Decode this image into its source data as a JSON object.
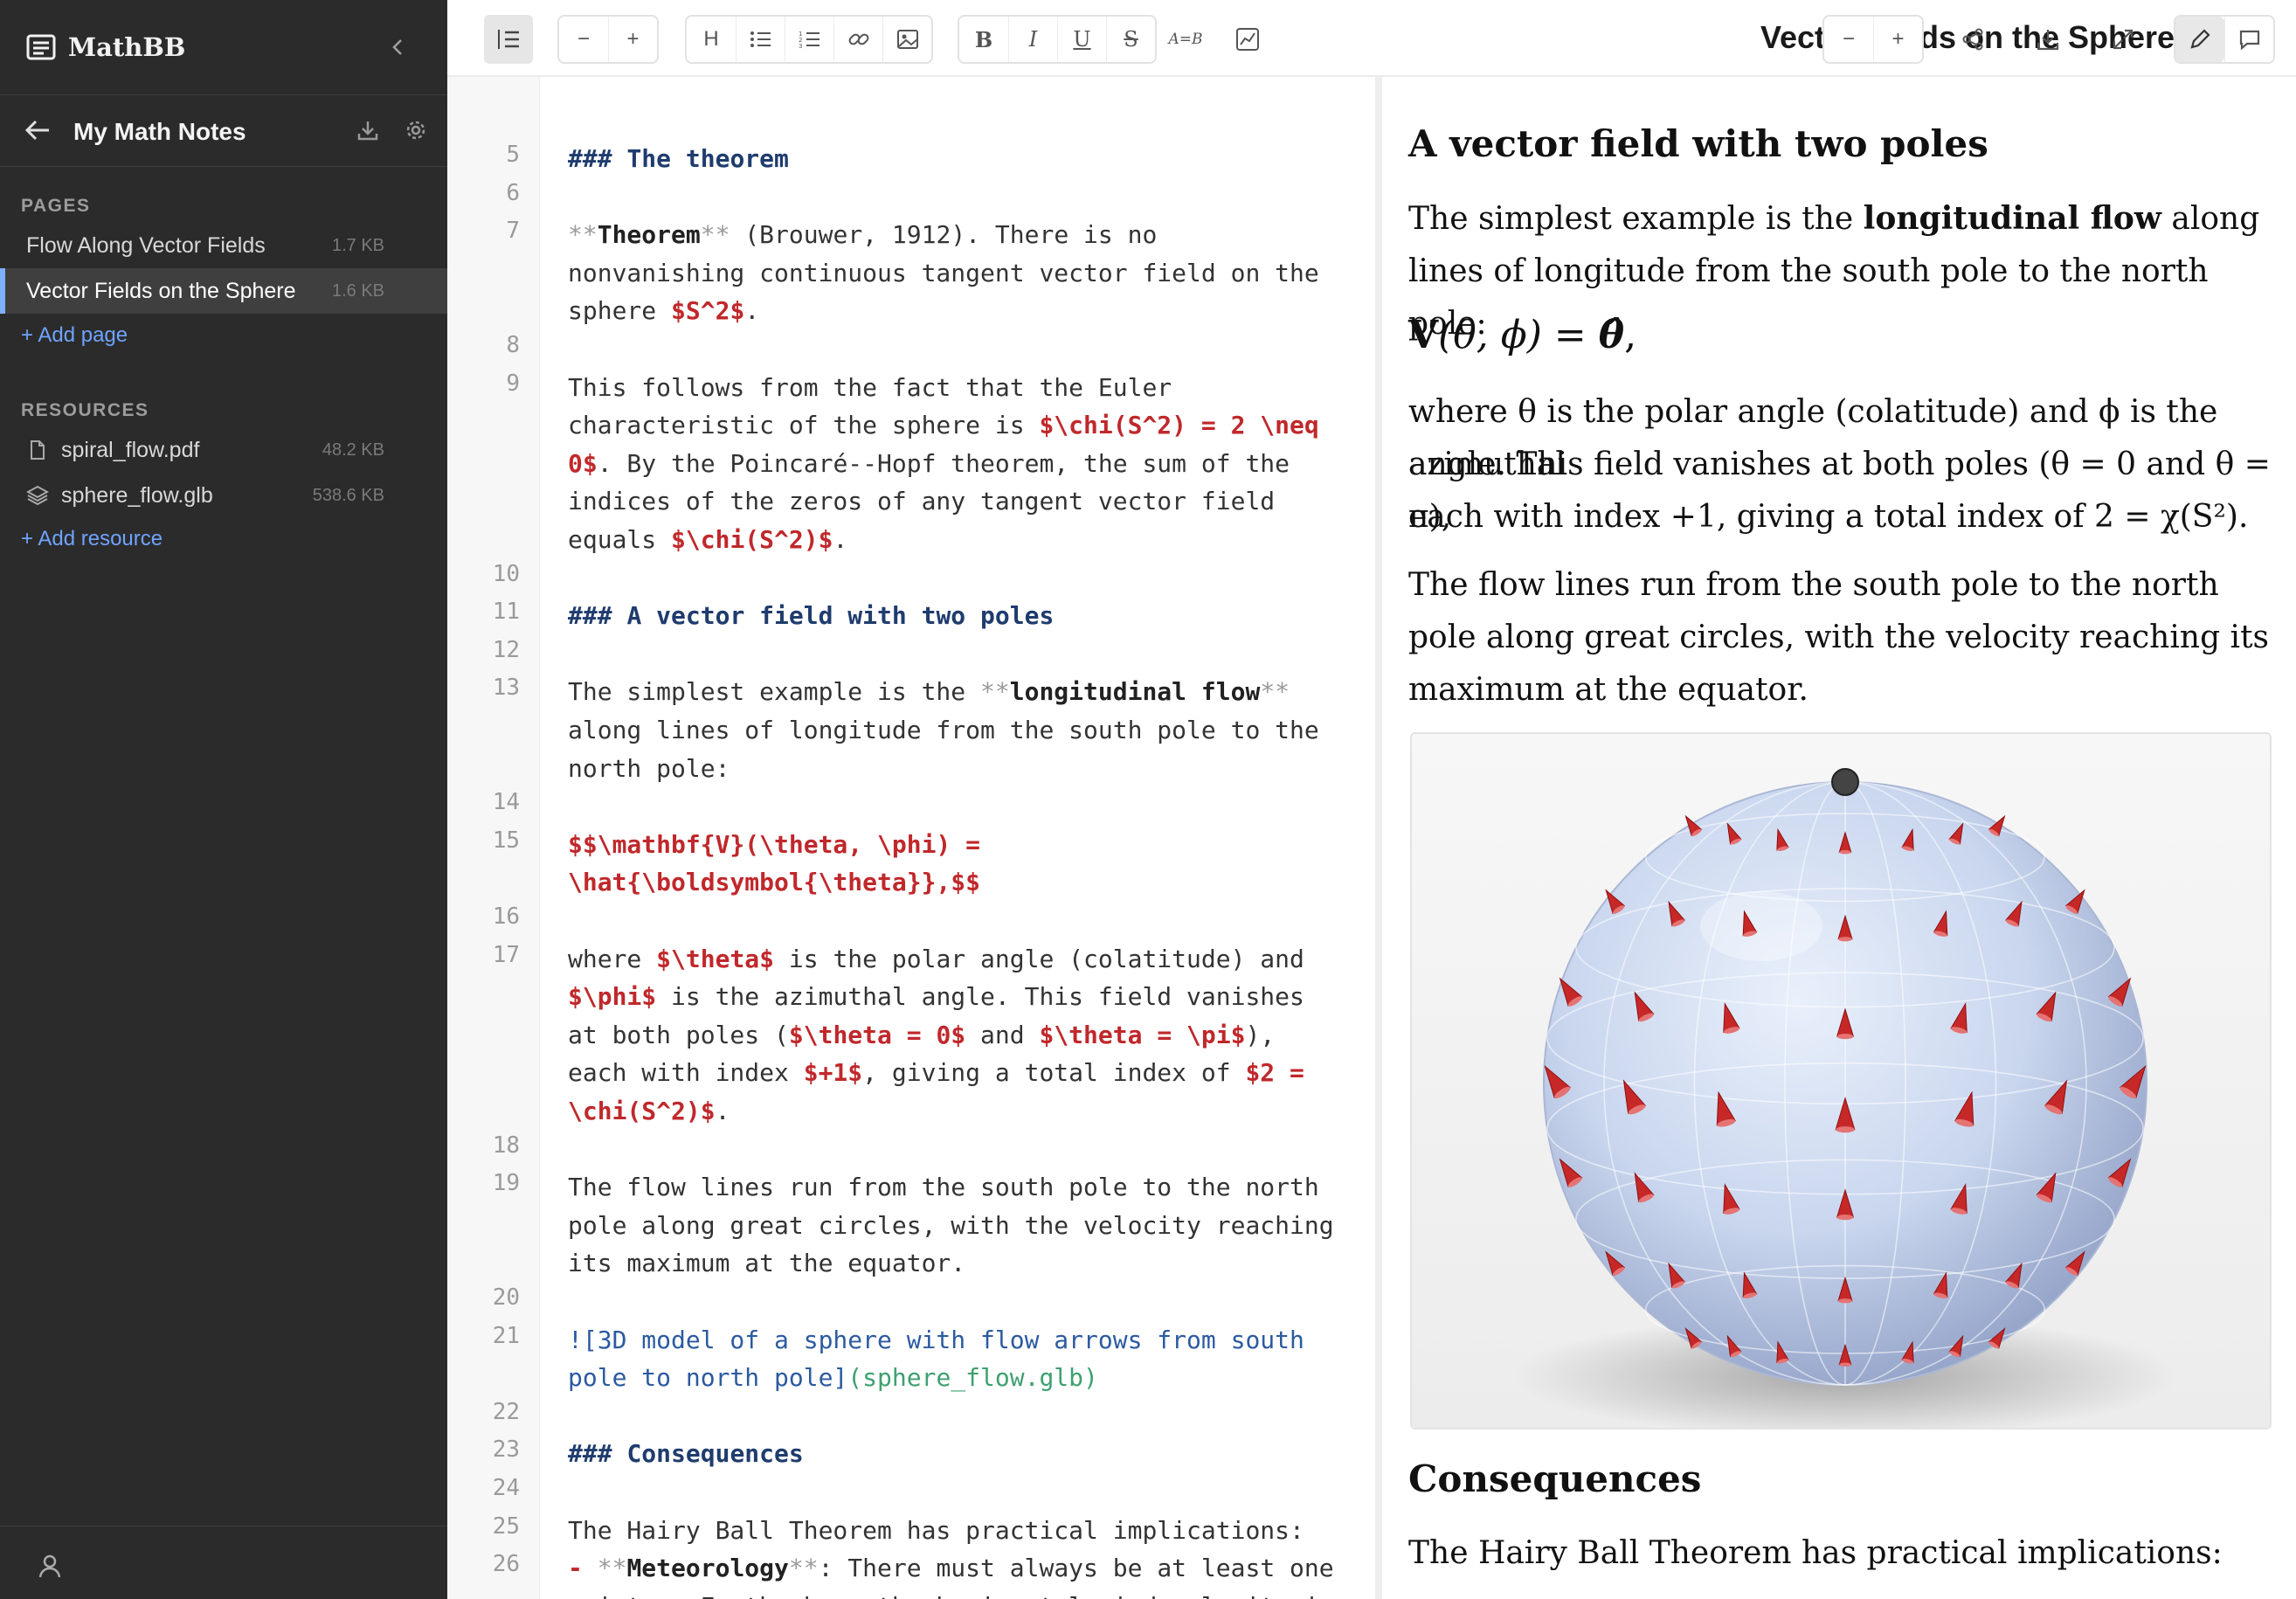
{
  "app": {
    "name": "MathBB"
  },
  "sidebar": {
    "notebook_title": "My Math Notes",
    "pages_heading": "PAGES",
    "pages": [
      {
        "label": "Flow Along Vector Fields",
        "size": "1.7 KB"
      },
      {
        "label": "Vector Fields on the Sphere",
        "size": "1.6 KB"
      }
    ],
    "add_page": "+ Add page",
    "resources_heading": "RESOURCES",
    "resources": [
      {
        "label": "spiral_flow.pdf",
        "size": "48.2 KB",
        "icon": "file-icon"
      },
      {
        "label": "sphere_flow.glb",
        "size": "538.6 KB",
        "icon": "3d-model-icon"
      }
    ],
    "add_resource": "+ Add resource"
  },
  "toolbar": {
    "doc_title": "Vector Fields on the Sphere",
    "zoom_out": "−",
    "zoom_in": "+",
    "heading": "H",
    "bold": "B",
    "italic": "I",
    "underline": "U",
    "strike": "S",
    "equation": "A=B"
  },
  "editor": {
    "lines": [
      {
        "n": "5",
        "parts": [
          {
            "t": "### ",
            "c": "h"
          },
          {
            "t": "The theorem",
            "c": "h"
          }
        ]
      },
      {
        "n": "6",
        "parts": []
      },
      {
        "n": "7",
        "parts": [
          {
            "t": "**",
            "c": "mk"
          },
          {
            "t": "Theorem",
            "c": "hb"
          },
          {
            "t": "**",
            "c": "mk"
          },
          {
            "t": " (Brouwer, 1912). There is no",
            "c": ""
          }
        ]
      },
      {
        "n": "",
        "parts": [
          {
            "t": "nonvanishing continuous tangent vector field on the",
            "c": ""
          }
        ]
      },
      {
        "n": "",
        "parts": [
          {
            "t": "sphere ",
            "c": ""
          },
          {
            "t": "$S^2$",
            "c": "m"
          },
          {
            "t": ".",
            "c": ""
          }
        ]
      },
      {
        "n": "8",
        "parts": []
      },
      {
        "n": "9",
        "parts": [
          {
            "t": "This follows from the fact that the Euler",
            "c": ""
          }
        ]
      },
      {
        "n": "",
        "parts": [
          {
            "t": "characteristic of the sphere is ",
            "c": ""
          },
          {
            "t": "$\\chi(S^2) = 2 \\neq",
            "c": "m"
          }
        ]
      },
      {
        "n": "",
        "parts": [
          {
            "t": "0$",
            "c": "m"
          },
          {
            "t": ". By the Poincaré--Hopf theorem, the sum of the",
            "c": ""
          }
        ]
      },
      {
        "n": "",
        "parts": [
          {
            "t": "indices of the zeros of any tangent vector field",
            "c": ""
          }
        ]
      },
      {
        "n": "",
        "parts": [
          {
            "t": "equals ",
            "c": ""
          },
          {
            "t": "$\\chi(S^2)$",
            "c": "m"
          },
          {
            "t": ".",
            "c": ""
          }
        ]
      },
      {
        "n": "10",
        "parts": []
      },
      {
        "n": "11",
        "parts": [
          {
            "t": "### ",
            "c": "h"
          },
          {
            "t": "A vector field with two poles",
            "c": "h"
          }
        ]
      },
      {
        "n": "12",
        "parts": []
      },
      {
        "n": "13",
        "parts": [
          {
            "t": "The simplest example is the ",
            "c": ""
          },
          {
            "t": "**",
            "c": "mk"
          },
          {
            "t": "longitudinal flow",
            "c": "hb"
          },
          {
            "t": "**",
            "c": "mk"
          }
        ]
      },
      {
        "n": "",
        "parts": [
          {
            "t": "along lines of longitude from the south pole to the",
            "c": ""
          }
        ]
      },
      {
        "n": "",
        "parts": [
          {
            "t": "north pole:",
            "c": ""
          }
        ]
      },
      {
        "n": "14",
        "parts": []
      },
      {
        "n": "15",
        "parts": [
          {
            "t": "$$\\mathbf{V}(\\theta, \\phi) =",
            "c": "m"
          }
        ]
      },
      {
        "n": "",
        "parts": [
          {
            "t": "\\hat{\\boldsymbol{\\theta}},$$",
            "c": "m"
          }
        ]
      },
      {
        "n": "16",
        "parts": []
      },
      {
        "n": "17",
        "parts": [
          {
            "t": "where ",
            "c": ""
          },
          {
            "t": "$\\theta$",
            "c": "m"
          },
          {
            "t": " is the polar angle (colatitude) and",
            "c": ""
          }
        ]
      },
      {
        "n": "",
        "parts": [
          {
            "t": "$\\phi$",
            "c": "m"
          },
          {
            "t": " is the azimuthal angle. This field vanishes",
            "c": ""
          }
        ]
      },
      {
        "n": "",
        "parts": [
          {
            "t": "at both poles (",
            "c": ""
          },
          {
            "t": "$\\theta = 0$",
            "c": "m"
          },
          {
            "t": " and ",
            "c": ""
          },
          {
            "t": "$\\theta = \\pi$",
            "c": "m"
          },
          {
            "t": "),",
            "c": ""
          }
        ]
      },
      {
        "n": "",
        "parts": [
          {
            "t": "each with index ",
            "c": ""
          },
          {
            "t": "$+1$",
            "c": "m"
          },
          {
            "t": ", giving a total index of ",
            "c": ""
          },
          {
            "t": "$2 =",
            "c": "m"
          }
        ]
      },
      {
        "n": "",
        "parts": [
          {
            "t": "\\chi(S^2)$",
            "c": "m"
          },
          {
            "t": ".",
            "c": ""
          }
        ]
      },
      {
        "n": "18",
        "parts": []
      },
      {
        "n": "19",
        "parts": [
          {
            "t": "The flow lines run from the south pole to the north",
            "c": ""
          }
        ]
      },
      {
        "n": "",
        "parts": [
          {
            "t": "pole along great circles, with the velocity reaching",
            "c": ""
          }
        ]
      },
      {
        "n": "",
        "parts": [
          {
            "t": "its maximum at the equator.",
            "c": ""
          }
        ]
      },
      {
        "n": "20",
        "parts": []
      },
      {
        "n": "21",
        "parts": [
          {
            "t": "![3D model of a sphere with flow arrows from south",
            "c": "lk"
          }
        ]
      },
      {
        "n": "",
        "parts": [
          {
            "t": "pole to north pole]",
            "c": "lk"
          },
          {
            "t": "(sphere_flow.glb)",
            "c": "url"
          }
        ]
      },
      {
        "n": "22",
        "parts": []
      },
      {
        "n": "23",
        "parts": [
          {
            "t": "### ",
            "c": "h"
          },
          {
            "t": "Consequences",
            "c": "h"
          }
        ]
      },
      {
        "n": "24",
        "parts": []
      },
      {
        "n": "25",
        "parts": [
          {
            "t": "The Hairy Ball Theorem has practical implications:",
            "c": ""
          }
        ]
      },
      {
        "n": "26",
        "parts": [
          {
            "t": "- ",
            "c": "m"
          },
          {
            "t": "**",
            "c": "mk"
          },
          {
            "t": "Meteorology",
            "c": "hb"
          },
          {
            "t": "**",
            "c": "mk"
          },
          {
            "t": ": There must always be at least one",
            "c": ""
          }
        ]
      },
      {
        "n": "",
        "parts": [
          {
            "t": "point on Earth where the horizontal wind velocity is",
            "c": ""
          }
        ]
      }
    ]
  },
  "preview": {
    "h_two_poles": "A vector field with two poles",
    "p1_a": "The simplest example is the ",
    "p1_b": "longitudinal flow",
    "p1_c": " along lines of longitude from the south pole to the north pole:",
    "eq_lhs": "V",
    "eq_args": "(θ, ϕ) = ",
    "eq_rhs": "θ̂",
    "eq_tail": ",",
    "p2_l1": "where θ is the polar angle (colatitude) and ϕ is the azimuthal",
    "p2_l2": "angle. This field vanishes at both poles (θ = 0 and θ = π),",
    "p2_l3": "each with index +1, giving a total index of 2 = χ(S²).",
    "p3": "The flow lines run from the south pole to the north pole along great circles, with the velocity reaching its maximum at the equator.",
    "figure_alt": "3D model of a sphere with flow arrows from south pole to north pole",
    "h_consequences": "Consequences",
    "p4": "The Hairy Ball Theorem has practical implications:"
  }
}
